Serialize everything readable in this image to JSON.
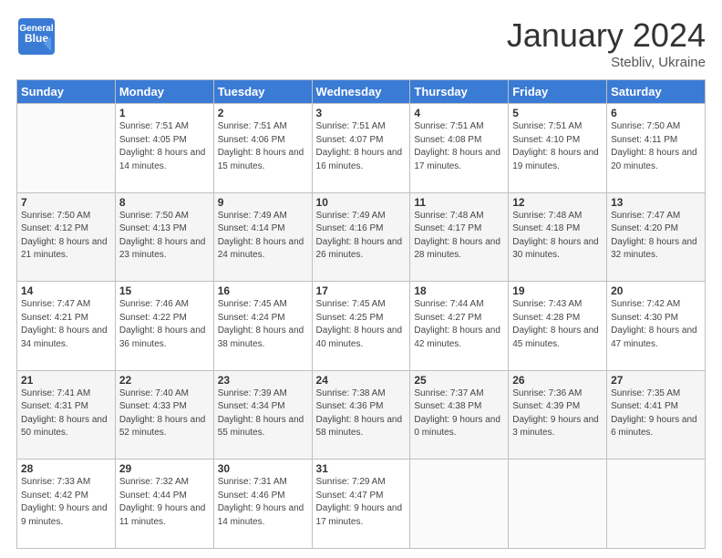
{
  "header": {
    "logo_general": "General",
    "logo_blue": "Blue",
    "month_title": "January 2024",
    "location": "Stebliv, Ukraine"
  },
  "weekdays": [
    "Sunday",
    "Monday",
    "Tuesday",
    "Wednesday",
    "Thursday",
    "Friday",
    "Saturday"
  ],
  "weeks": [
    [
      {
        "day": "",
        "sunrise": "",
        "sunset": "",
        "daylight": ""
      },
      {
        "day": "1",
        "sunrise": "Sunrise: 7:51 AM",
        "sunset": "Sunset: 4:05 PM",
        "daylight": "Daylight: 8 hours and 14 minutes."
      },
      {
        "day": "2",
        "sunrise": "Sunrise: 7:51 AM",
        "sunset": "Sunset: 4:06 PM",
        "daylight": "Daylight: 8 hours and 15 minutes."
      },
      {
        "day": "3",
        "sunrise": "Sunrise: 7:51 AM",
        "sunset": "Sunset: 4:07 PM",
        "daylight": "Daylight: 8 hours and 16 minutes."
      },
      {
        "day": "4",
        "sunrise": "Sunrise: 7:51 AM",
        "sunset": "Sunset: 4:08 PM",
        "daylight": "Daylight: 8 hours and 17 minutes."
      },
      {
        "day": "5",
        "sunrise": "Sunrise: 7:51 AM",
        "sunset": "Sunset: 4:10 PM",
        "daylight": "Daylight: 8 hours and 19 minutes."
      },
      {
        "day": "6",
        "sunrise": "Sunrise: 7:50 AM",
        "sunset": "Sunset: 4:11 PM",
        "daylight": "Daylight: 8 hours and 20 minutes."
      }
    ],
    [
      {
        "day": "7",
        "sunrise": "Sunrise: 7:50 AM",
        "sunset": "Sunset: 4:12 PM",
        "daylight": "Daylight: 8 hours and 21 minutes."
      },
      {
        "day": "8",
        "sunrise": "Sunrise: 7:50 AM",
        "sunset": "Sunset: 4:13 PM",
        "daylight": "Daylight: 8 hours and 23 minutes."
      },
      {
        "day": "9",
        "sunrise": "Sunrise: 7:49 AM",
        "sunset": "Sunset: 4:14 PM",
        "daylight": "Daylight: 8 hours and 24 minutes."
      },
      {
        "day": "10",
        "sunrise": "Sunrise: 7:49 AM",
        "sunset": "Sunset: 4:16 PM",
        "daylight": "Daylight: 8 hours and 26 minutes."
      },
      {
        "day": "11",
        "sunrise": "Sunrise: 7:48 AM",
        "sunset": "Sunset: 4:17 PM",
        "daylight": "Daylight: 8 hours and 28 minutes."
      },
      {
        "day": "12",
        "sunrise": "Sunrise: 7:48 AM",
        "sunset": "Sunset: 4:18 PM",
        "daylight": "Daylight: 8 hours and 30 minutes."
      },
      {
        "day": "13",
        "sunrise": "Sunrise: 7:47 AM",
        "sunset": "Sunset: 4:20 PM",
        "daylight": "Daylight: 8 hours and 32 minutes."
      }
    ],
    [
      {
        "day": "14",
        "sunrise": "Sunrise: 7:47 AM",
        "sunset": "Sunset: 4:21 PM",
        "daylight": "Daylight: 8 hours and 34 minutes."
      },
      {
        "day": "15",
        "sunrise": "Sunrise: 7:46 AM",
        "sunset": "Sunset: 4:22 PM",
        "daylight": "Daylight: 8 hours and 36 minutes."
      },
      {
        "day": "16",
        "sunrise": "Sunrise: 7:45 AM",
        "sunset": "Sunset: 4:24 PM",
        "daylight": "Daylight: 8 hours and 38 minutes."
      },
      {
        "day": "17",
        "sunrise": "Sunrise: 7:45 AM",
        "sunset": "Sunset: 4:25 PM",
        "daylight": "Daylight: 8 hours and 40 minutes."
      },
      {
        "day": "18",
        "sunrise": "Sunrise: 7:44 AM",
        "sunset": "Sunset: 4:27 PM",
        "daylight": "Daylight: 8 hours and 42 minutes."
      },
      {
        "day": "19",
        "sunrise": "Sunrise: 7:43 AM",
        "sunset": "Sunset: 4:28 PM",
        "daylight": "Daylight: 8 hours and 45 minutes."
      },
      {
        "day": "20",
        "sunrise": "Sunrise: 7:42 AM",
        "sunset": "Sunset: 4:30 PM",
        "daylight": "Daylight: 8 hours and 47 minutes."
      }
    ],
    [
      {
        "day": "21",
        "sunrise": "Sunrise: 7:41 AM",
        "sunset": "Sunset: 4:31 PM",
        "daylight": "Daylight: 8 hours and 50 minutes."
      },
      {
        "day": "22",
        "sunrise": "Sunrise: 7:40 AM",
        "sunset": "Sunset: 4:33 PM",
        "daylight": "Daylight: 8 hours and 52 minutes."
      },
      {
        "day": "23",
        "sunrise": "Sunrise: 7:39 AM",
        "sunset": "Sunset: 4:34 PM",
        "daylight": "Daylight: 8 hours and 55 minutes."
      },
      {
        "day": "24",
        "sunrise": "Sunrise: 7:38 AM",
        "sunset": "Sunset: 4:36 PM",
        "daylight": "Daylight: 8 hours and 58 minutes."
      },
      {
        "day": "25",
        "sunrise": "Sunrise: 7:37 AM",
        "sunset": "Sunset: 4:38 PM",
        "daylight": "Daylight: 9 hours and 0 minutes."
      },
      {
        "day": "26",
        "sunrise": "Sunrise: 7:36 AM",
        "sunset": "Sunset: 4:39 PM",
        "daylight": "Daylight: 9 hours and 3 minutes."
      },
      {
        "day": "27",
        "sunrise": "Sunrise: 7:35 AM",
        "sunset": "Sunset: 4:41 PM",
        "daylight": "Daylight: 9 hours and 6 minutes."
      }
    ],
    [
      {
        "day": "28",
        "sunrise": "Sunrise: 7:33 AM",
        "sunset": "Sunset: 4:42 PM",
        "daylight": "Daylight: 9 hours and 9 minutes."
      },
      {
        "day": "29",
        "sunrise": "Sunrise: 7:32 AM",
        "sunset": "Sunset: 4:44 PM",
        "daylight": "Daylight: 9 hours and 11 minutes."
      },
      {
        "day": "30",
        "sunrise": "Sunrise: 7:31 AM",
        "sunset": "Sunset: 4:46 PM",
        "daylight": "Daylight: 9 hours and 14 minutes."
      },
      {
        "day": "31",
        "sunrise": "Sunrise: 7:29 AM",
        "sunset": "Sunset: 4:47 PM",
        "daylight": "Daylight: 9 hours and 17 minutes."
      },
      {
        "day": "",
        "sunrise": "",
        "sunset": "",
        "daylight": ""
      },
      {
        "day": "",
        "sunrise": "",
        "sunset": "",
        "daylight": ""
      },
      {
        "day": "",
        "sunrise": "",
        "sunset": "",
        "daylight": ""
      }
    ]
  ]
}
